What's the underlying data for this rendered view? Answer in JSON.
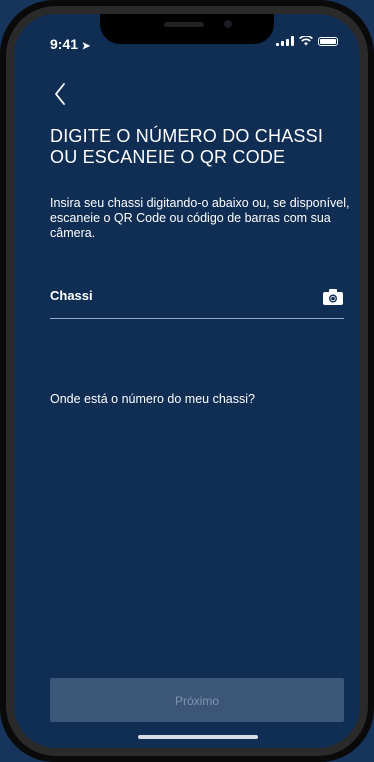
{
  "status_bar": {
    "time": "9:41"
  },
  "header": {
    "back_icon": "chevron-left-icon",
    "title": "DIGITE O NÚMERO DO CHASSI OU ESCANEIE O QR CODE"
  },
  "main": {
    "instructions": "Insira seu chassi digitando-o abaixo ou, se disponível, escaneie o QR Code ou código de barras com sua câmera.",
    "chassis_field": {
      "label": "Chassi",
      "value": "",
      "camera_icon": "camera-icon"
    },
    "help_link": "Onde está o número do meu chassi?"
  },
  "footer": {
    "next_label": "Próximo"
  },
  "colors": {
    "background": "#102e54",
    "text": "#ffffff",
    "button_disabled_bg": "#3c5678",
    "button_disabled_text": "#8194ae"
  }
}
